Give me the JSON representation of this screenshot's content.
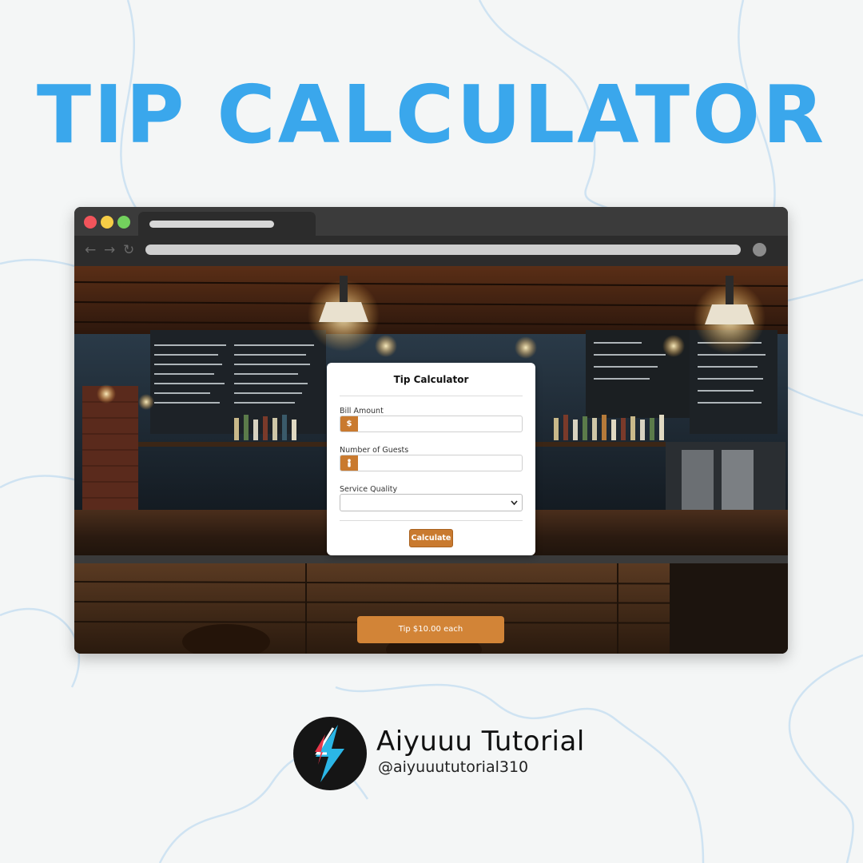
{
  "headline": "TIP CALCULATOR",
  "colors": {
    "headline": "#3aa7ec",
    "accent": "#c97a2f",
    "result_button": "#d28437",
    "background": "#f4f6f6",
    "browser_frame": "#2c2c2c"
  },
  "browser": {
    "traffic_lights": [
      "#f2545b",
      "#f6cd46",
      "#73d15d"
    ],
    "nav_icons": [
      "back-arrow-icon",
      "forward-arrow-icon",
      "reload-icon"
    ]
  },
  "calculator": {
    "title": "Tip Calculator",
    "bill_label": "Bill Amount",
    "bill_addon": "$",
    "bill_value": "",
    "guests_label": "Number of Guests",
    "guests_addon_icon": "person-icon",
    "guests_value": "",
    "service_label": "Service Quality",
    "service_value": "",
    "calculate_label": "Calculate"
  },
  "result": {
    "label": "Tip $10.00 each"
  },
  "brand": {
    "name": "Aiyuuu Tutorial",
    "handle": "@aiyuuututorial310",
    "logo_icon": "lightning-bolt-logo"
  }
}
